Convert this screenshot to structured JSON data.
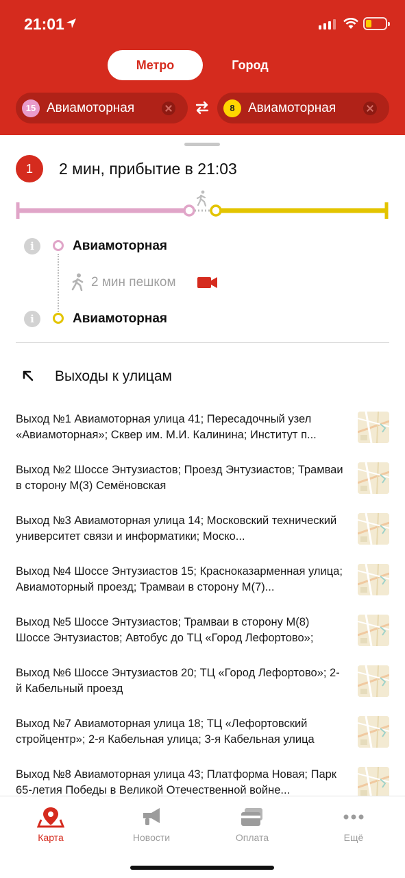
{
  "status_bar": {
    "time": "21:01"
  },
  "mode_tabs": {
    "metro": "Метро",
    "city": "Город"
  },
  "route_input": {
    "from": {
      "line_number": "15",
      "station": "Авиамоторная",
      "line_color": "#e99bcb"
    },
    "to": {
      "line_number": "8",
      "station": "Авиамоторная",
      "line_color": "#ffd600"
    }
  },
  "route": {
    "number": "1",
    "title": "2 мин, прибытие в 21:03",
    "stops": [
      {
        "name": "Авиамоторная",
        "line_color": "#e99bcb"
      },
      {
        "name": "Авиамоторная",
        "line_color": "#ffd600"
      }
    ],
    "walk": "2 мин пешком"
  },
  "exits": {
    "title": "Выходы к улицам",
    "items": [
      "Выход №1 Авиамоторная улица 41; Пересадочный узел «Авиамоторная»; Сквер им. М.И. Калинина; Институт п...",
      "Выход №2 Шоссе Энтузиастов; Проезд Энтузиастов; Трамваи в сторону М(3) Семёновская",
      "Выход №3 Авиамоторная улица 14; Московский технический университет связи и информатики; Моско...",
      "Выход №4 Шоссе Энтузиастов 15; Красноказарменная улица; Авиамоторный проезд; Трамваи в сторону М(7)...",
      "Выход №5 Шоссе Энтузиастов; Трамваи в сторону М(8) Шоссе Энтузиастов; Автобус до ТЦ «Город Лефортово»;",
      "Выход №6 Шоссе Энтузиастов 20; ТЦ «Город Лефортово»; 2-й Кабельный проезд",
      "Выход №7 Авиамоторная улица 18; ТЦ «Лефортовский стройцентр»; 2-я Кабельная улица; 3-я Кабельная улица",
      "Выход №8 Авиамоторная улица 43; Платформа Новая; Парк 65-летия Победы в Великой Отечественной войне..."
    ]
  },
  "tabbar": {
    "items": [
      {
        "label": "Карта",
        "icon": "map-pin-icon",
        "active": true
      },
      {
        "label": "Новости",
        "icon": "megaphone-icon",
        "active": false
      },
      {
        "label": "Оплата",
        "icon": "cards-icon",
        "active": false
      },
      {
        "label": "Ещё",
        "icon": "more-dots-icon",
        "active": false
      }
    ]
  },
  "colors": {
    "accent": "#d52b1e",
    "line15": "#e99bcb",
    "line8": "#ffd600"
  }
}
